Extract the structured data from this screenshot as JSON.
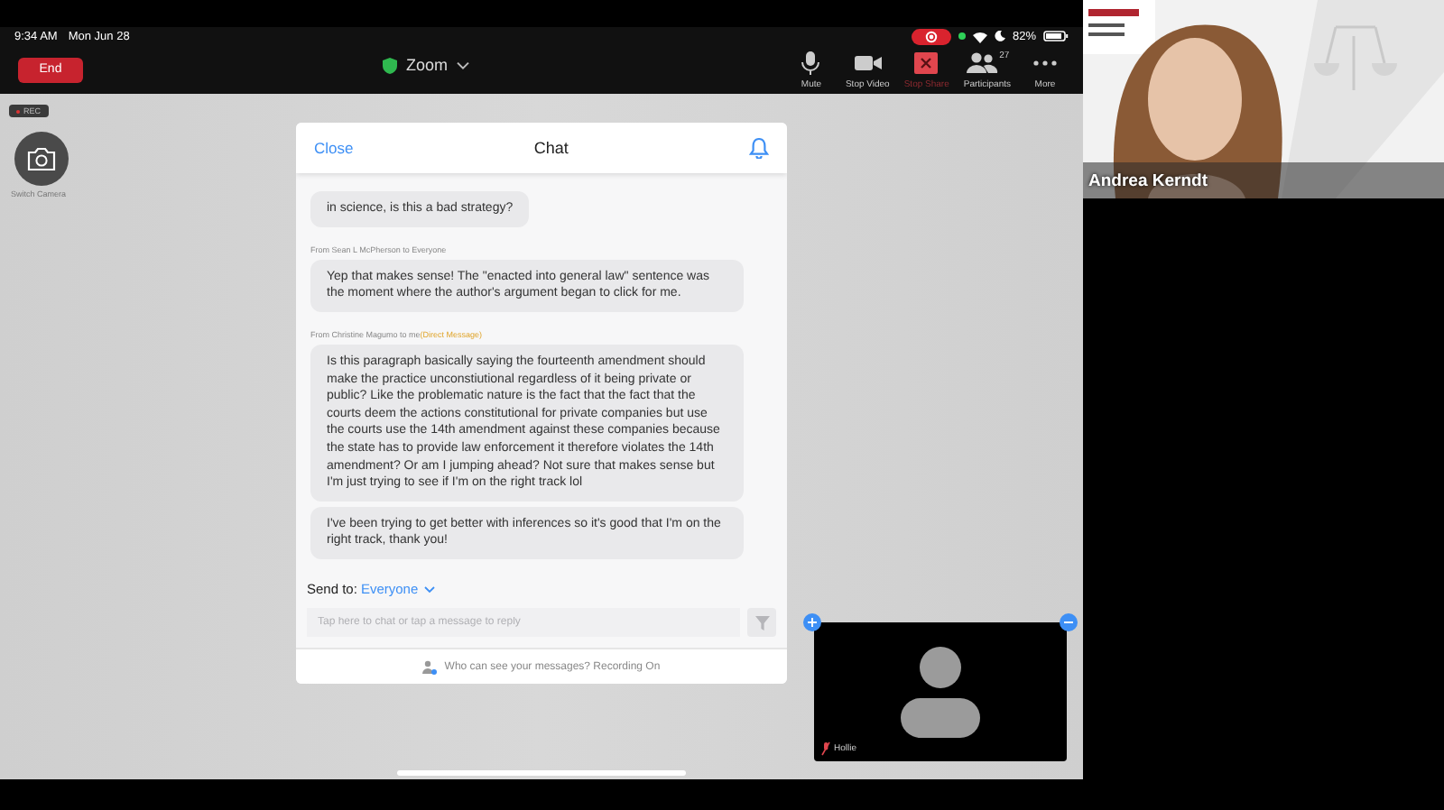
{
  "status_bar": {
    "time": "9:34 AM",
    "date": "Mon Jun 28",
    "battery": "82%"
  },
  "toolbar": {
    "end_button": "End",
    "title": "Zoom",
    "actions": [
      {
        "kind": "mic",
        "label": "Mute"
      },
      {
        "kind": "video",
        "label": "Stop Video"
      },
      {
        "kind": "share",
        "label": "Stop Share"
      },
      {
        "kind": "participants",
        "label": "Participants",
        "count": "27"
      },
      {
        "kind": "more",
        "label": "More"
      }
    ]
  },
  "left_controls": {
    "rec_badge": "REC",
    "switch_camera": "Switch Camera"
  },
  "chat": {
    "close": "Close",
    "title": "Chat",
    "messages": [
      {
        "bubbles": [
          "in science, is this a bad strategy?"
        ]
      },
      {
        "header": {
          "from_label": "From",
          "sender": "Sean L McPherson",
          "to_label": "to",
          "recipient": "Everyone"
        },
        "bubbles": [
          "Yep that makes sense! The \"enacted into general law\" sentence was the moment where the author's argument began to click for me."
        ]
      },
      {
        "header": {
          "from_label": "From",
          "sender": "Christine Magumo",
          "to_label": "to",
          "recipient": "me",
          "note": "(Direct Message)"
        },
        "bubbles": [
          "Is this paragraph basically saying the fourteenth amendment should make the practice unconstiutional regardless of it being private or public? Like the problematic nature is the fact that the fact that the courts deem the actions constitutional for private companies but use the courts use the 14th amendment against these companies because the state has to provide law enforcement it therefore violates the 14th amendment? Or am I jumping ahead? Not sure that makes sense but I'm just trying to see if I'm on the right track lol",
          "I've been trying to get better with inferences so it's good that I'm on the right track, thank you!"
        ]
      }
    ],
    "send_to_label": "Send to:",
    "send_to_value": "Everyone",
    "input_placeholder": "Tap here to chat or tap a message to reply",
    "footer": "Who can see your messages? Recording On"
  },
  "thumbnail": {
    "name": "Hollie",
    "muted": true
  },
  "speaker_video": {
    "name": "Andrea Kerndt"
  }
}
